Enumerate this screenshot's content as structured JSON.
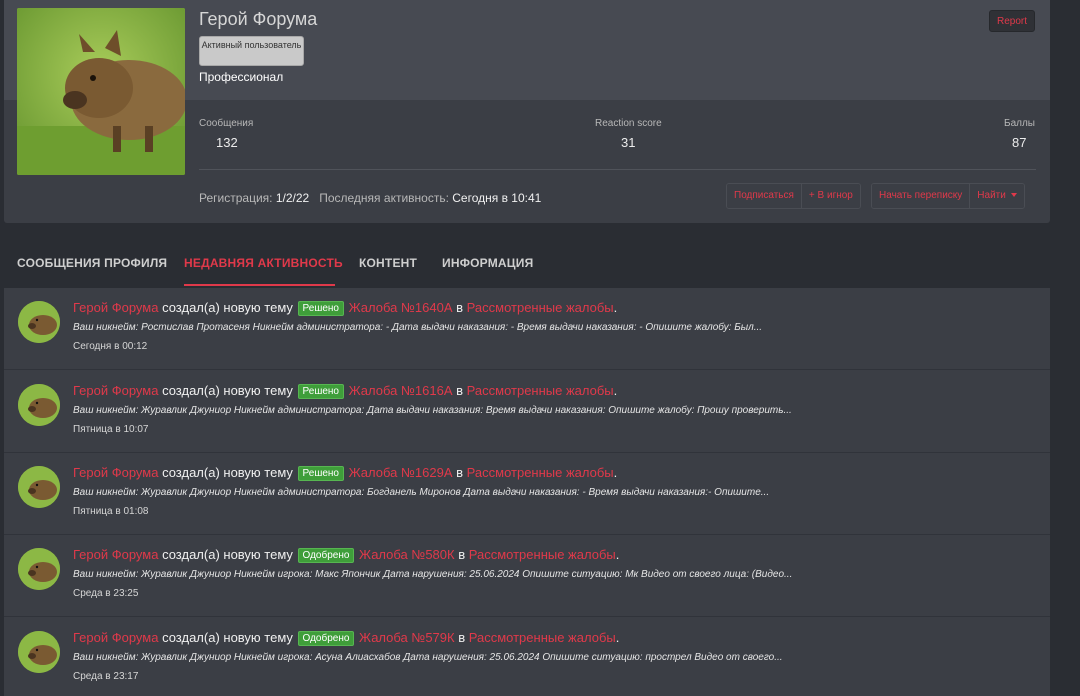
{
  "profile": {
    "username": "Герой Форума",
    "badge": "Активный пользователь",
    "title": "Профессионал",
    "report_label": "Report",
    "stats": [
      {
        "label": "Сообщения",
        "value": "132"
      },
      {
        "label": "Reaction score",
        "value": "31"
      },
      {
        "label": "Баллы",
        "value": "87"
      }
    ],
    "registration_label": "Регистрация:",
    "registration_value": "1/2/22",
    "last_activity_label": "Последняя активность:",
    "last_activity_value": "Сегодня в 10:41",
    "actions": {
      "subscribe": "Подписаться",
      "ignore": "+ В игнор",
      "start_conversation": "Начать переписку",
      "find": "Найти"
    }
  },
  "tabs": [
    {
      "label": "СООБЩЕНИЯ ПРОФИЛЯ"
    },
    {
      "label": "НЕДАВНЯЯ АКТИВНОСТЬ"
    },
    {
      "label": "КОНТЕНТ"
    },
    {
      "label": "ИНФОРМАЦИЯ"
    }
  ],
  "activity": {
    "author": "Герой Форума",
    "action_text": "создал(а) новую тему",
    "in_text": "в",
    "items": [
      {
        "status": "Решено",
        "status_color": "#3f9e3a",
        "thread": "Жалоба №1640А",
        "forum": "Рассмотренные жалобы",
        "snippet": "Ваш никнейм: Ростислав Протасеня Никнейм администратора: - Дата выдачи наказания: - Время выдачи наказания: - Опишите жалобу: Был...",
        "time": "Сегодня в 00:12"
      },
      {
        "status": "Решено",
        "status_color": "#3f9e3a",
        "thread": "Жалоба №1616А",
        "forum": "Рассмотренные жалобы",
        "snippet": "Ваш никнейм: Журавлик Джуниор Никнейм администратора: Дата выдачи наказания: Время выдачи наказания: Опишите жалобу: Прошу проверить...",
        "time": "Пятница в 10:07"
      },
      {
        "status": "Решено",
        "status_color": "#3f9e3a",
        "thread": "Жалоба №1629А",
        "forum": "Рассмотренные жалобы",
        "snippet": "Ваш никнейм: Журавлик Джуниор Никнейм администратора: Богданель Миронов Дата выдачи наказания: - Время выдачи наказания:- Опишите...",
        "time": "Пятница в 01:08"
      },
      {
        "status": "Одобрено",
        "status_color": "#3f9e3a",
        "thread": "Жалоба №580К",
        "forum": "Рассмотренные жалобы",
        "snippet": "Ваш никнейм: Журавлик Джуниор Никнейм игрока: Макс Япончик Дата нарушения: 25.06.2024 Опишите ситуацию: Мк Видео от своего лица: (Видео...",
        "time": "Среда в 23:25"
      },
      {
        "status": "Одобрено",
        "status_color": "#3f9e3a",
        "thread": "Жалоба №579К",
        "forum": "Рассмотренные жалобы",
        "snippet": "Ваш никнейм: Журавлик Джуниор Никнейм игрока: Асуна Алиасхабов Дата нарушения: 25.06.2024 Опишите ситуацию: прострел Видео от своего...",
        "time": "Среда в 23:17"
      }
    ]
  }
}
